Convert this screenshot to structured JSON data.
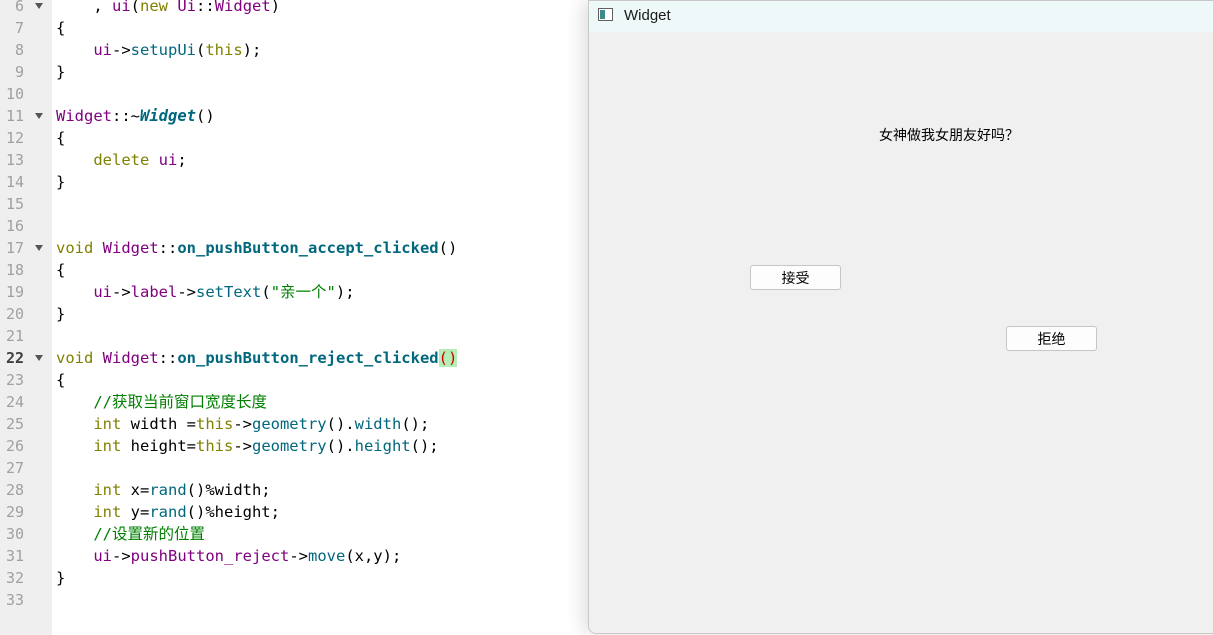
{
  "editor": {
    "lines": [
      {
        "num": "6",
        "fold": true,
        "tokens": [
          [
            "    , ",
            ""
          ],
          [
            "ui",
            "ty"
          ],
          [
            "(",
            ""
          ],
          [
            "new",
            "kw"
          ],
          [
            " ",
            ""
          ],
          [
            "Ui",
            "ty"
          ],
          [
            "::",
            ""
          ],
          [
            "Widget",
            "ty"
          ],
          [
            ")",
            ""
          ]
        ]
      },
      {
        "num": "7",
        "fold": false,
        "tokens": [
          [
            "{",
            ""
          ]
        ]
      },
      {
        "num": "8",
        "fold": false,
        "tokens": [
          [
            "    ",
            ""
          ],
          [
            "ui",
            "ty"
          ],
          [
            "->",
            ""
          ],
          [
            "setupUi",
            "fn"
          ],
          [
            "(",
            ""
          ],
          [
            "this",
            "kw"
          ],
          [
            ");",
            ""
          ]
        ]
      },
      {
        "num": "9",
        "fold": false,
        "tokens": [
          [
            "}",
            ""
          ]
        ]
      },
      {
        "num": "10",
        "fold": false,
        "tokens": []
      },
      {
        "num": "11",
        "fold": true,
        "tokens": [
          [
            "Widget",
            "ty"
          ],
          [
            "::~",
            ""
          ],
          [
            "Widget",
            "fnbi"
          ],
          [
            "()",
            ""
          ]
        ]
      },
      {
        "num": "12",
        "fold": false,
        "tokens": [
          [
            "{",
            ""
          ]
        ]
      },
      {
        "num": "13",
        "fold": false,
        "tokens": [
          [
            "    ",
            ""
          ],
          [
            "delete",
            "kw"
          ],
          [
            " ",
            ""
          ],
          [
            "ui",
            "ty"
          ],
          [
            ";",
            ""
          ]
        ]
      },
      {
        "num": "14",
        "fold": false,
        "tokens": [
          [
            "}",
            ""
          ]
        ]
      },
      {
        "num": "15",
        "fold": false,
        "tokens": []
      },
      {
        "num": "16",
        "fold": false,
        "tokens": []
      },
      {
        "num": "17",
        "fold": true,
        "tokens": [
          [
            "void",
            "kw"
          ],
          [
            " ",
            ""
          ],
          [
            "Widget",
            "ty"
          ],
          [
            "::",
            ""
          ],
          [
            "on_pushButton_accept_clicked",
            "fnb"
          ],
          [
            "()",
            ""
          ]
        ]
      },
      {
        "num": "18",
        "fold": false,
        "tokens": [
          [
            "{",
            ""
          ]
        ]
      },
      {
        "num": "19",
        "fold": false,
        "tokens": [
          [
            "    ",
            ""
          ],
          [
            "ui",
            "ty"
          ],
          [
            "->",
            ""
          ],
          [
            "label",
            "ty"
          ],
          [
            "->",
            ""
          ],
          [
            "setText",
            "fn"
          ],
          [
            "(",
            ""
          ],
          [
            "\"亲一个\"",
            "str"
          ],
          [
            ");",
            ""
          ]
        ]
      },
      {
        "num": "20",
        "fold": false,
        "tokens": [
          [
            "}",
            ""
          ]
        ]
      },
      {
        "num": "21",
        "fold": false,
        "tokens": []
      },
      {
        "num": "22",
        "fold": true,
        "current": true,
        "tokens": [
          [
            "void",
            "kw"
          ],
          [
            " ",
            ""
          ],
          [
            "Widget",
            "ty"
          ],
          [
            "::",
            ""
          ],
          [
            "on_pushButton_reject_clicked",
            "fnb"
          ],
          [
            "()",
            "hl"
          ]
        ]
      },
      {
        "num": "23",
        "fold": false,
        "tokens": [
          [
            "{",
            ""
          ]
        ]
      },
      {
        "num": "24",
        "fold": false,
        "tokens": [
          [
            "    ",
            ""
          ],
          [
            "//获取当前窗口宽度长度",
            "cmt"
          ]
        ]
      },
      {
        "num": "25",
        "fold": false,
        "tokens": [
          [
            "    ",
            ""
          ],
          [
            "int",
            "kw"
          ],
          [
            " width =",
            ""
          ],
          [
            "this",
            "kw"
          ],
          [
            "->",
            ""
          ],
          [
            "geometry",
            "fn"
          ],
          [
            "().",
            ""
          ],
          [
            "width",
            "fn"
          ],
          [
            "();",
            ""
          ]
        ]
      },
      {
        "num": "26",
        "fold": false,
        "tokens": [
          [
            "    ",
            ""
          ],
          [
            "int",
            "kw"
          ],
          [
            " height=",
            ""
          ],
          [
            "this",
            "kw"
          ],
          [
            "->",
            ""
          ],
          [
            "geometry",
            "fn"
          ],
          [
            "().",
            ""
          ],
          [
            "height",
            "fn"
          ],
          [
            "();",
            ""
          ]
        ]
      },
      {
        "num": "27",
        "fold": false,
        "tokens": []
      },
      {
        "num": "28",
        "fold": false,
        "tokens": [
          [
            "    ",
            ""
          ],
          [
            "int",
            "kw"
          ],
          [
            " x=",
            ""
          ],
          [
            "rand",
            "fn"
          ],
          [
            "()%width;",
            ""
          ]
        ]
      },
      {
        "num": "29",
        "fold": false,
        "tokens": [
          [
            "    ",
            ""
          ],
          [
            "int",
            "kw"
          ],
          [
            " y=",
            ""
          ],
          [
            "rand",
            "fn"
          ],
          [
            "()%height;",
            ""
          ]
        ]
      },
      {
        "num": "30",
        "fold": false,
        "tokens": [
          [
            "    ",
            ""
          ],
          [
            "//设置新的位置",
            "cmt"
          ]
        ]
      },
      {
        "num": "31",
        "fold": false,
        "tokens": [
          [
            "    ",
            ""
          ],
          [
            "ui",
            "ty"
          ],
          [
            "->",
            ""
          ],
          [
            "pushButton_reject",
            "ty"
          ],
          [
            "->",
            ""
          ],
          [
            "move",
            "fn"
          ],
          [
            "(x,y);",
            ""
          ]
        ]
      },
      {
        "num": "32",
        "fold": false,
        "tokens": [
          [
            "}",
            ""
          ]
        ]
      },
      {
        "num": "33",
        "fold": false,
        "tokens": []
      }
    ]
  },
  "window": {
    "title": "Widget",
    "icon": "qt-window-icon",
    "label_text": "女神做我女朋友好吗？",
    "accept_label": "接受",
    "reject_label": "拒绝"
  },
  "colors": {
    "keyword": "#808000",
    "type": "#800080",
    "function": "#00677c",
    "string": "#008000",
    "comment": "#008000",
    "paren_highlight": "#b4eeb4"
  }
}
